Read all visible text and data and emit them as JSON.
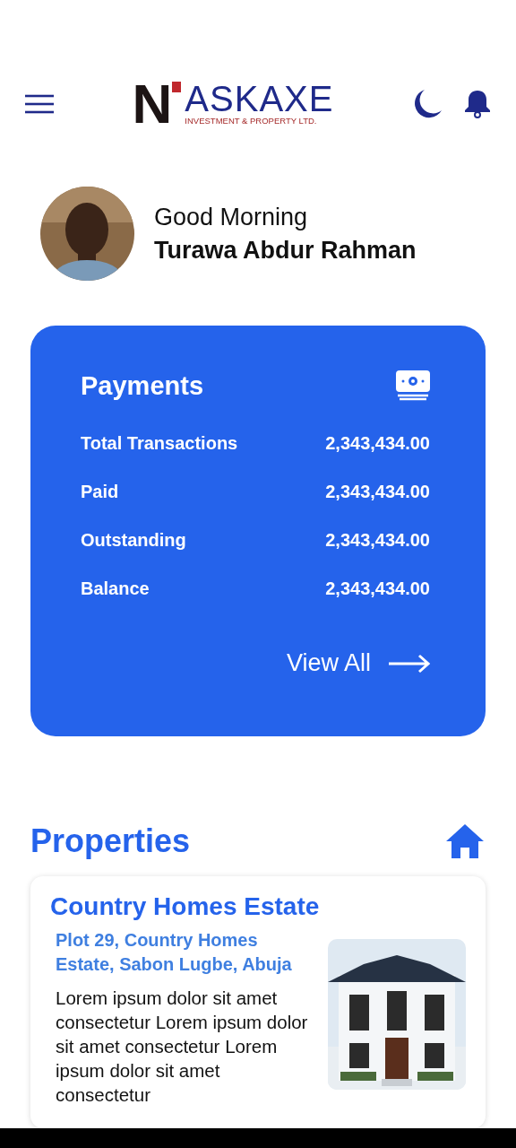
{
  "header": {
    "logo": {
      "mark": "N",
      "name": "ASKAXE",
      "tagline": "INVESTMENT & PROPERTY LTD."
    }
  },
  "greeting": {
    "salutation": "Good Morning",
    "name": "Turawa Abdur Rahman"
  },
  "payments": {
    "title": "Payments",
    "rows": [
      {
        "label": "Total Transactions",
        "value": "2,343,434.00"
      },
      {
        "label": "Paid",
        "value": "2,343,434.00"
      },
      {
        "label": "Outstanding",
        "value": "2,343,434.00"
      },
      {
        "label": "Balance",
        "value": "2,343,434.00"
      }
    ],
    "link": "View All"
  },
  "properties": {
    "title": "Properties",
    "items": [
      {
        "name": "Country Homes Estate",
        "address": "Plot 29, Country Homes Estate, Sabon Lugbe, Abuja",
        "description": "Lorem ipsum dolor sit amet consectetur Lorem ipsum dolor sit amet consectetur Lorem ipsum dolor sit amet consectetur"
      }
    ]
  }
}
